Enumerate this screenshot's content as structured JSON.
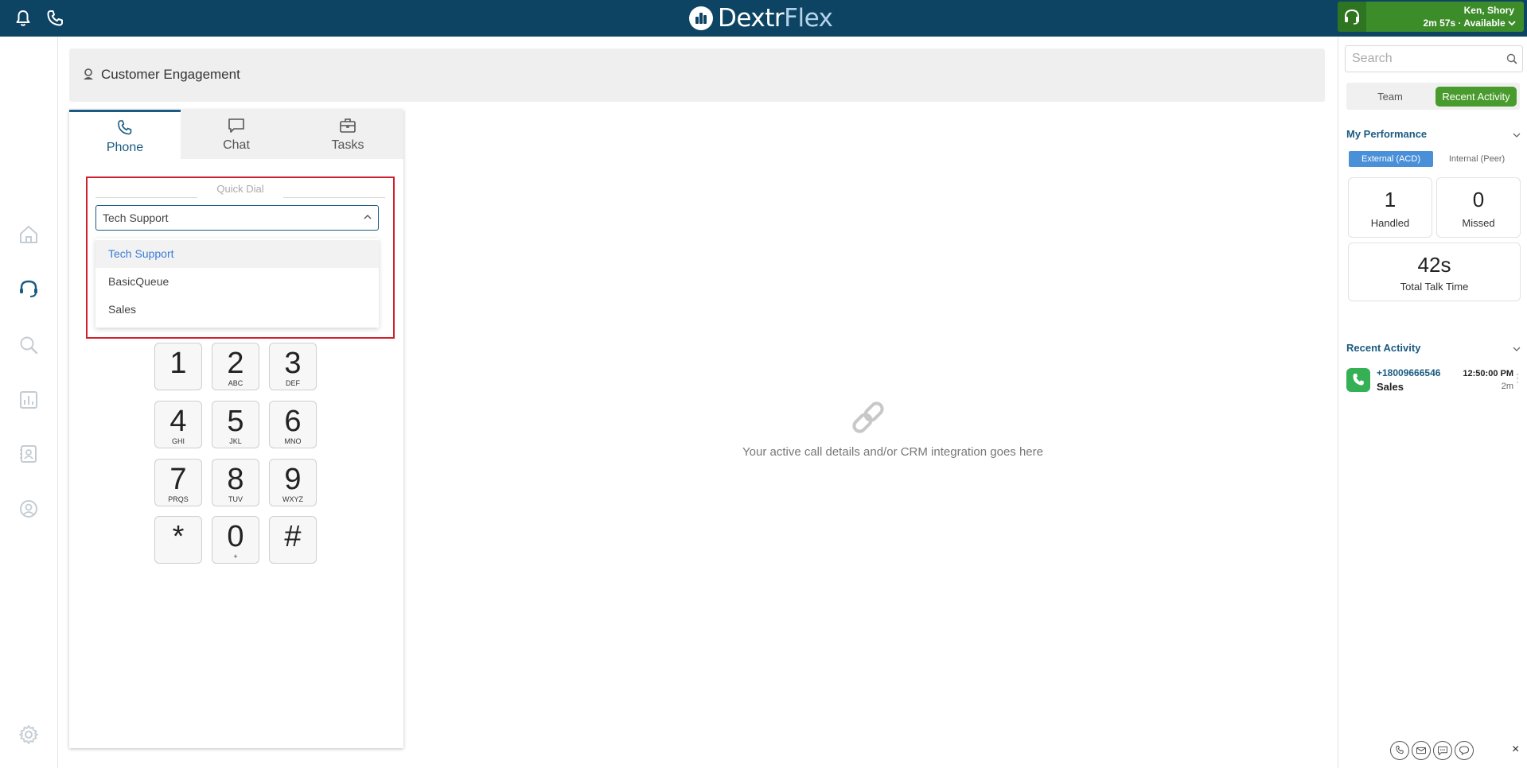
{
  "app": {
    "logo_part1": "Dextr",
    "logo_part2": "Flex"
  },
  "agent": {
    "name": "Ken, Shory",
    "status": "2m 57s · Available"
  },
  "header": {
    "title": "Customer Engagement"
  },
  "tabs": [
    {
      "label": "Phone",
      "icon": "phone-icon"
    },
    {
      "label": "Chat",
      "icon": "chat-bubble-icon"
    },
    {
      "label": "Tasks",
      "icon": "briefcase-icon"
    }
  ],
  "quick_dial": {
    "label": "Quick Dial",
    "selected": "Tech Support",
    "options": [
      "Tech Support",
      "BasicQueue",
      "Sales"
    ]
  },
  "keypad": [
    {
      "digit": "1",
      "letters": ""
    },
    {
      "digit": "2",
      "letters": "ABC"
    },
    {
      "digit": "3",
      "letters": "DEF"
    },
    {
      "digit": "4",
      "letters": "GHI"
    },
    {
      "digit": "5",
      "letters": "JKL"
    },
    {
      "digit": "6",
      "letters": "MNO"
    },
    {
      "digit": "7",
      "letters": "PRQS"
    },
    {
      "digit": "8",
      "letters": "TUV"
    },
    {
      "digit": "9",
      "letters": "WXYZ"
    },
    {
      "digit": "*",
      "letters": ""
    },
    {
      "digit": "0",
      "letters": "+"
    },
    {
      "digit": "#",
      "letters": ""
    }
  ],
  "crm_placeholder": "Your active call details and/or CRM integration goes here",
  "sidebar": {
    "search_placeholder": "Search",
    "team_label": "Team",
    "recent_activity_label": "Recent Activity",
    "my_performance": "My Performance",
    "external_label": "External (ACD)",
    "internal_label": "Internal (Peer)",
    "handled_count": "1",
    "handled_label": "Handled",
    "missed_count": "0",
    "missed_label": "Missed",
    "talk_time": "42s",
    "talk_time_label": "Total Talk Time",
    "recent_activity_title": "Recent Activity",
    "activity": {
      "number": "+18009666546",
      "queue": "Sales",
      "time": "12:50:00 PM",
      "duration": "2m"
    },
    "close_label": "×"
  },
  "colors": {
    "topbar": "#0e4463",
    "accent_green": "#4a9b2e",
    "accent_blue": "#1a5b82",
    "highlight_red": "#d0202e"
  }
}
